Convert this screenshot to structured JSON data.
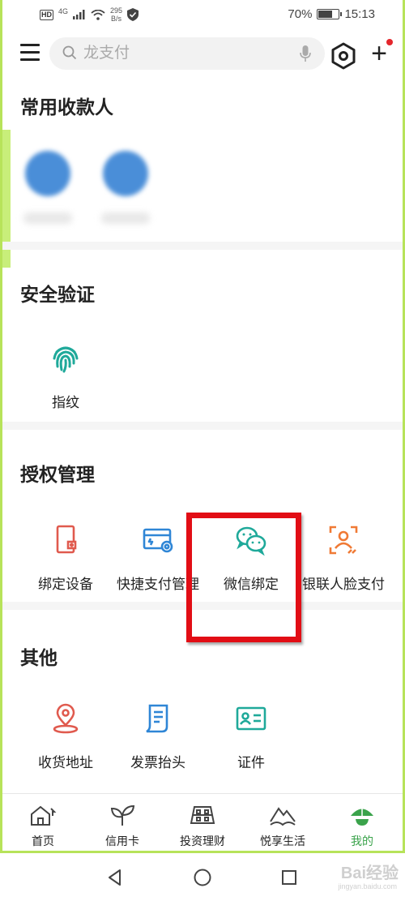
{
  "status_bar": {
    "hd": "HD",
    "network": "4G",
    "speed_value": "295",
    "speed_unit": "B/s",
    "battery": "70%",
    "battery_level": 0.7,
    "time": "15:13"
  },
  "top_bar": {
    "search_placeholder": "龙支付",
    "plus_label": "+"
  },
  "sections": {
    "payees_title": "常用收款人",
    "security_title": "安全验证",
    "auth_title": "授权管理",
    "other_title": "其他"
  },
  "security_items": [
    {
      "label": "指纹",
      "icon": "fingerprint-icon"
    }
  ],
  "auth_items": [
    {
      "label": "绑定设备",
      "icon": "device-icon"
    },
    {
      "label": "快捷支付管理",
      "icon": "card-settings-icon"
    },
    {
      "label": "微信绑定",
      "icon": "wechat-icon"
    },
    {
      "label": "银联人脸支付",
      "icon": "face-pay-icon"
    }
  ],
  "other_items": [
    {
      "label": "收货地址",
      "icon": "location-icon"
    },
    {
      "label": "发票抬头",
      "icon": "invoice-icon"
    },
    {
      "label": "证件",
      "icon": "id-card-icon"
    }
  ],
  "tabs": [
    {
      "label": "首页",
      "icon": "home-icon"
    },
    {
      "label": "信用卡",
      "icon": "sprout-icon"
    },
    {
      "label": "投资理财",
      "icon": "investment-icon"
    },
    {
      "label": "悦享生活",
      "icon": "mountain-icon"
    },
    {
      "label": "我的",
      "icon": "profile-icon",
      "active": true
    }
  ],
  "watermark": {
    "text": "Bai经验",
    "sub": "jingyan.baidu.com"
  },
  "colors": {
    "accent_green": "#3aa34b",
    "icon_teal": "#1fa99a",
    "icon_red": "#e05a4e",
    "icon_blue": "#2f86d6",
    "icon_orange": "#f07a35",
    "highlight_red": "#e20d15"
  }
}
